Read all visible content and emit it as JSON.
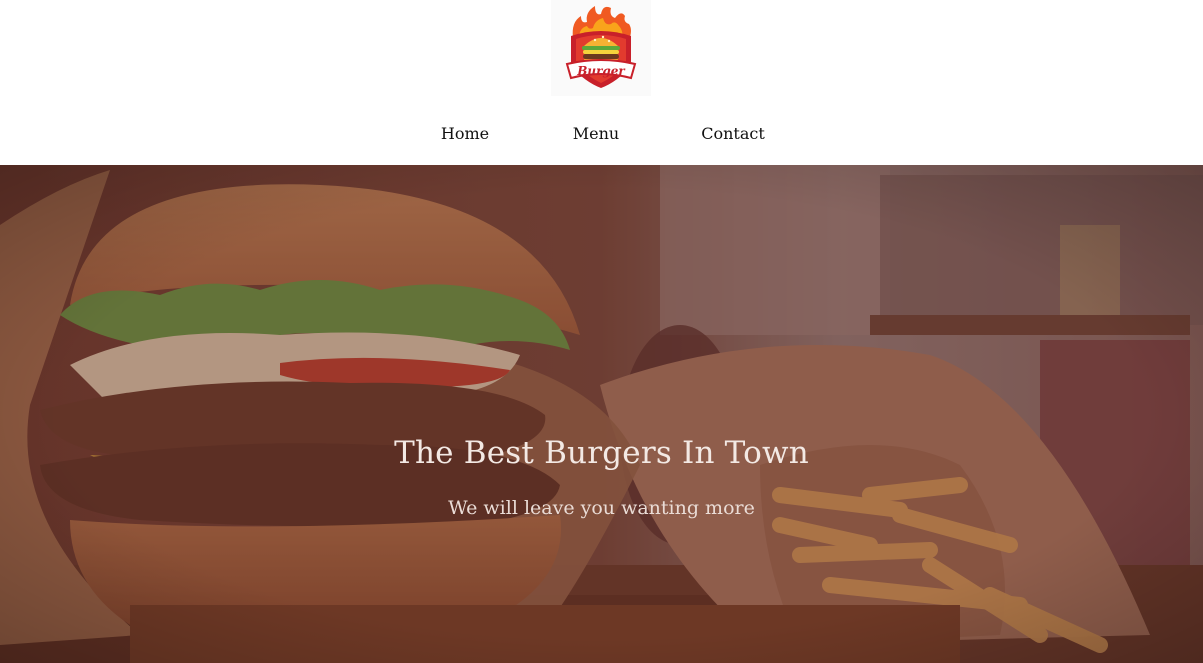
{
  "logo": {
    "text": "Burger",
    "icon": "burger-flame-logo-icon"
  },
  "nav": {
    "items": [
      {
        "label": "Home"
      },
      {
        "label": "Menu"
      },
      {
        "label": "Contact"
      }
    ]
  },
  "hero": {
    "title": "The Best Burgers In Town",
    "subtitle": "We will leave you wanting more",
    "overlay_color": "#5a2a28"
  }
}
